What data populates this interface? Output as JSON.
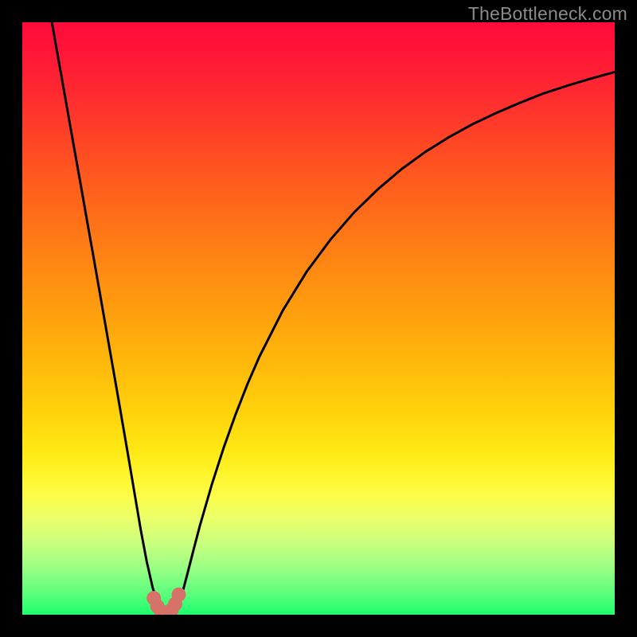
{
  "watermark": "TheBottleneck.com",
  "gradient": {
    "stops": [
      {
        "offset": 0.0,
        "color": "#ff0a3c"
      },
      {
        "offset": 0.06,
        "color": "#ff1837"
      },
      {
        "offset": 0.12,
        "color": "#ff2a30"
      },
      {
        "offset": 0.18,
        "color": "#ff3e28"
      },
      {
        "offset": 0.24,
        "color": "#ff5220"
      },
      {
        "offset": 0.3,
        "color": "#ff651b"
      },
      {
        "offset": 0.36,
        "color": "#ff7816"
      },
      {
        "offset": 0.42,
        "color": "#ff8a12"
      },
      {
        "offset": 0.48,
        "color": "#ff9c0e"
      },
      {
        "offset": 0.54,
        "color": "#ffae0c"
      },
      {
        "offset": 0.6,
        "color": "#ffc00b"
      },
      {
        "offset": 0.66,
        "color": "#ffd30c"
      },
      {
        "offset": 0.72,
        "color": "#ffe713"
      },
      {
        "offset": 0.76,
        "color": "#fff428"
      },
      {
        "offset": 0.8,
        "color": "#fcfd4a"
      },
      {
        "offset": 0.84,
        "color": "#eaff6a"
      },
      {
        "offset": 0.88,
        "color": "#c8ff7e"
      },
      {
        "offset": 0.92,
        "color": "#9bff84"
      },
      {
        "offset": 0.96,
        "color": "#63ff7e"
      },
      {
        "offset": 1.0,
        "color": "#1cff6e"
      }
    ]
  },
  "chart_data": {
    "type": "line",
    "title": "",
    "xlabel": "",
    "ylabel": "",
    "xlim": [
      0,
      100
    ],
    "ylim": [
      0,
      100
    ],
    "series": [
      {
        "name": "bottleneck-curve",
        "x": [
          5,
          6,
          7,
          8,
          9,
          10,
          11,
          12,
          13,
          14,
          15,
          16,
          17,
          18,
          19,
          20,
          21,
          22,
          23,
          23.5,
          24,
          24.5,
          25,
          25.5,
          26,
          27,
          28,
          29,
          30,
          32,
          34,
          36,
          38,
          40,
          44,
          48,
          52,
          56,
          60,
          64,
          68,
          72,
          76,
          80,
          84,
          88,
          92,
          96,
          100
        ],
        "y": [
          100,
          94.3,
          88.7,
          83.0,
          77.4,
          71.8,
          66.1,
          60.5,
          54.8,
          49.1,
          43.4,
          37.7,
          31.9,
          26.1,
          20.2,
          14.3,
          9.0,
          4.6,
          1.4,
          0.6,
          0.2,
          0.1,
          0.1,
          0.3,
          0.9,
          3.6,
          7.4,
          11.3,
          15.1,
          22.0,
          28.2,
          33.8,
          38.9,
          43.5,
          51.4,
          57.9,
          63.3,
          67.9,
          71.8,
          75.2,
          78.1,
          80.6,
          82.8,
          84.7,
          86.4,
          88.0,
          89.3,
          90.5,
          91.6
        ]
      }
    ],
    "marker_region": {
      "x": [
        22.2,
        22.8,
        23.4,
        24.0,
        24.6,
        25.2,
        25.8,
        26.4
      ],
      "y": [
        2.8,
        1.4,
        0.6,
        0.3,
        0.3,
        0.8,
        1.8,
        3.4
      ]
    }
  },
  "style": {
    "curve_stroke": "#000000",
    "curve_width": 3,
    "marker_color": "#d67268",
    "marker_radius": 9
  }
}
